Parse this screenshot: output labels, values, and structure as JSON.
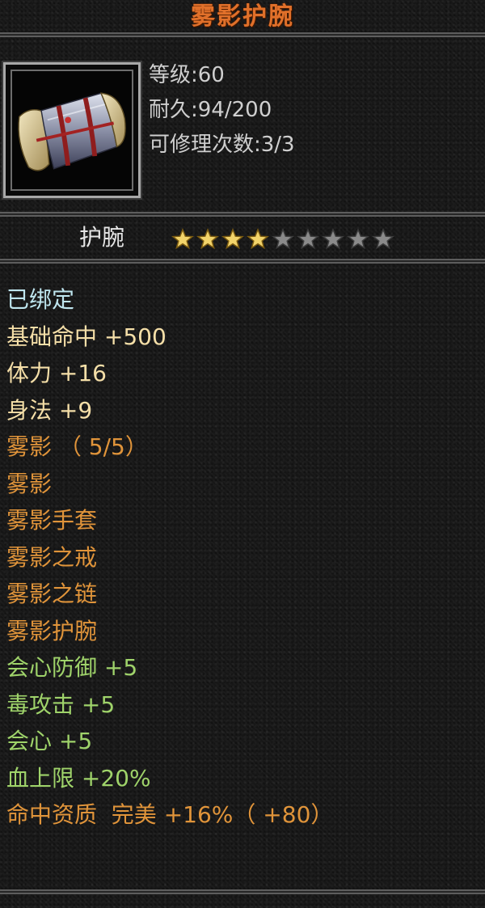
{
  "title": "雾影护腕",
  "colors": {
    "title": "#e0702a",
    "bound": "#bfe6ef",
    "base": "#f5dfa8",
    "set": "#e0943a",
    "bonus": "#9fd36a",
    "quality": "#e0943a",
    "star_filled": "#f2d36a",
    "star_empty": "#8a8a8a"
  },
  "item": {
    "icon": "bracer-icon",
    "level": "等级:60",
    "durability": "耐久:94/200",
    "repair_count": "可修理次数:3/3"
  },
  "type": {
    "label": "护腕",
    "stars_filled": 4,
    "stars_total": 9
  },
  "stats": [
    {
      "text": "已绑定",
      "kind": "bound"
    },
    {
      "text": "基础命中 +500",
      "kind": "base"
    },
    {
      "text": "体力 +16",
      "kind": "base"
    },
    {
      "text": "身法 +9",
      "kind": "base"
    },
    {
      "text": "雾影 （ 5/5）",
      "kind": "set"
    },
    {
      "text": "雾影",
      "kind": "set"
    },
    {
      "text": "雾影手套",
      "kind": "set"
    },
    {
      "text": "雾影之戒",
      "kind": "set"
    },
    {
      "text": "雾影之链",
      "kind": "set"
    },
    {
      "text": "雾影护腕",
      "kind": "set"
    },
    {
      "text": "会心防御 +5",
      "kind": "bonus"
    },
    {
      "text": "毒攻击 +5",
      "kind": "bonus"
    },
    {
      "text": "会心 +5",
      "kind": "bonus"
    },
    {
      "text": "血上限 +20%",
      "kind": "bonus"
    },
    {
      "text": "命中资质  完美 +16%（ +80）",
      "kind": "quality"
    }
  ]
}
